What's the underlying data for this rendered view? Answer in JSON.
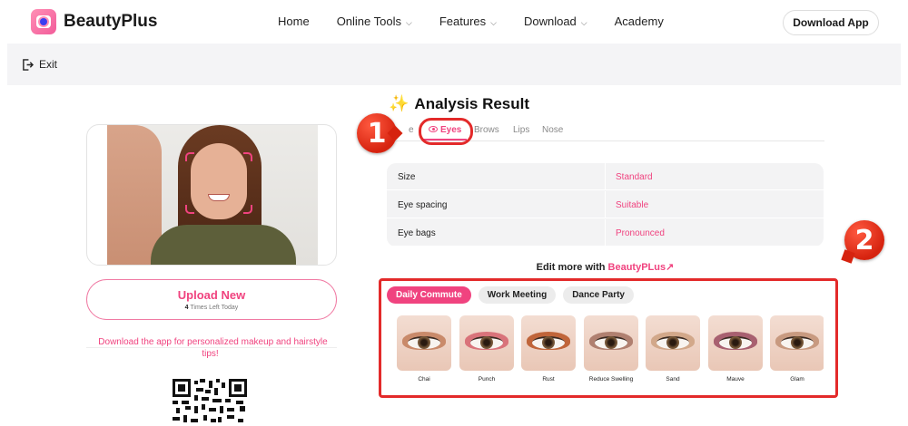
{
  "header": {
    "brand": "BeautyPlus",
    "nav": [
      {
        "label": "Home",
        "has_dropdown": false
      },
      {
        "label": "Online Tools",
        "has_dropdown": true
      },
      {
        "label": "Features",
        "has_dropdown": true
      },
      {
        "label": "Download",
        "has_dropdown": true
      },
      {
        "label": "Academy",
        "has_dropdown": false
      }
    ],
    "download_app": "Download App"
  },
  "exitbar": {
    "exit_label": "Exit"
  },
  "left": {
    "upload_title": "Upload New",
    "upload_count": "4",
    "upload_count_suffix": " Times Left Today",
    "promo": "Download the app for personalized makeup and hairstyle tips!"
  },
  "result": {
    "title": "Analysis Result",
    "tabs": [
      {
        "label": "e",
        "active": false
      },
      {
        "label": "Eyes",
        "active": true
      },
      {
        "label": "Brows",
        "active": false
      },
      {
        "label": "Lips",
        "active": false
      },
      {
        "label": "Nose",
        "active": false
      }
    ],
    "rows": [
      {
        "key": "Size",
        "value": "Standard"
      },
      {
        "key": "Eye spacing",
        "value": "Suitable"
      },
      {
        "key": "Eye bags",
        "value": "Pronounced"
      }
    ],
    "edit_more_prefix": "Edit more with ",
    "edit_more_brand": "BeautyPLus",
    "edit_more_arrow": "↗",
    "style_chips": [
      {
        "label": "Daily Commute",
        "active": true
      },
      {
        "label": "Work Meeting",
        "active": false
      },
      {
        "label": "Dance Party",
        "active": false
      }
    ],
    "looks": [
      {
        "label": "Chai",
        "lid_color": "#c98a6a"
      },
      {
        "label": "Punch",
        "lid_color": "#d9737a"
      },
      {
        "label": "Rust",
        "lid_color": "#c0653a"
      },
      {
        "label": "Reduce Swelling",
        "lid_color": "#b08070"
      },
      {
        "label": "Sand",
        "lid_color": "#d2a88a"
      },
      {
        "label": "Mauve",
        "lid_color": "#a86070"
      },
      {
        "label": "Glam",
        "lid_color": "#c89a80"
      }
    ]
  },
  "markers": {
    "one": "1",
    "two": "2"
  },
  "colors": {
    "accent": "#f0437f",
    "marker_red": "#e32a2a"
  }
}
